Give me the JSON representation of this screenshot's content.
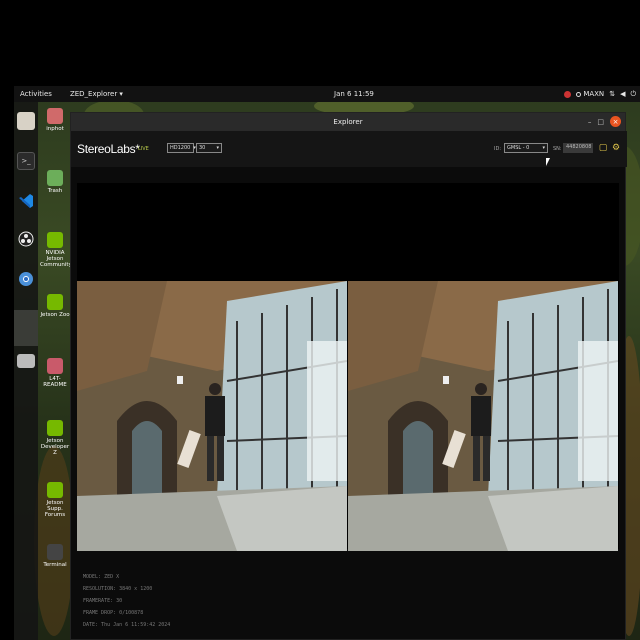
{
  "topbar": {
    "activities": "Activities",
    "app_menu": "ZED_Explorer ▾",
    "clock": "Jan 6 11:59",
    "power_mode": "MAXN",
    "tray_icons": [
      "nvidia-icon",
      "network-icon",
      "volume-icon",
      "power-icon"
    ]
  },
  "dock": {
    "items": [
      "files-icon",
      "terminal-icon",
      "vscode-icon",
      "obs-icon",
      "chromium-icon",
      "app-grid-icon",
      "drive-icon"
    ]
  },
  "desktop": {
    "icons": [
      {
        "label": "inphot",
        "icon": "home-folder-icon"
      },
      {
        "label": "Trash",
        "icon": "trash-icon"
      },
      {
        "label": "NVIDIA Jetson Community",
        "icon": "nvidia-link-icon"
      },
      {
        "label": "Jetson Zoo",
        "icon": "nvidia-link-icon"
      },
      {
        "label": "L4T-README",
        "icon": "folder-icon"
      },
      {
        "label": "Jetson Developer Z",
        "icon": "nvidia-link-icon"
      },
      {
        "label": "Jetson Supp. Forums",
        "icon": "nvidia-link-icon"
      },
      {
        "label": "Terminal",
        "icon": "terminal-icon"
      }
    ]
  },
  "window": {
    "title": "Explorer",
    "minimize": "–",
    "maximize": "□",
    "close": "×"
  },
  "toolbar": {
    "logo": "StereoLabs*",
    "live_label": "LIVE",
    "resolution_value": "HD1200",
    "fps_value": "30",
    "id_label": "ID:",
    "camera_value": "GMSL - 0",
    "sn_label": "SN:",
    "sn_value": "44820808"
  },
  "info": {
    "model": "MODEL: ZED X",
    "resolution": "RESOLUTION: 3840 x 1200",
    "framerate": "FRAMERATE: 30",
    "frame_drop": "FRAME DROP: 0/100878",
    "date": "DATE: Thu Jan 6 11:59:42 2024"
  },
  "colors": {
    "accent_orange": "#e95420",
    "live_green": "#b7c94a",
    "settings_gold": "#e0c54a"
  }
}
